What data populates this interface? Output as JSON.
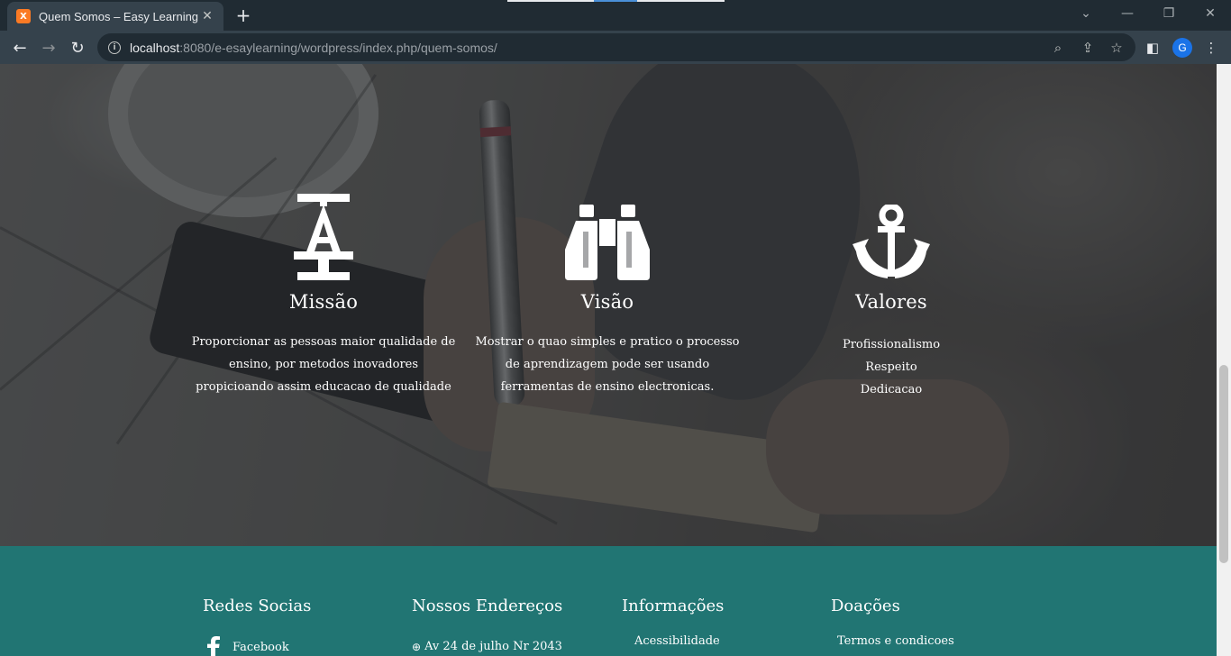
{
  "browser": {
    "tab_title": "Quem Somos – Easy Learning",
    "favicon_label": "X",
    "url_host": "localhost",
    "url_rest": ":8080/e-esaylearning/wordpress/index.php/quem-somos/",
    "profile_initial": "G"
  },
  "features": [
    {
      "icon": "caliper-icon",
      "title": "Missão",
      "text": "Proporcionar as pessoas maior qualidade de ensino, por metodos inovadores propicioando assim educacao de qualidade"
    },
    {
      "icon": "binoculars-icon",
      "title": "Visão",
      "text": "Mostrar o quao simples e pratico o processo de aprendizagem pode ser usando ferramentas de ensino electronicas."
    },
    {
      "icon": "anchor-icon",
      "title": "Valores",
      "values": [
        "Profissionalismo",
        "Respeito",
        "Dedicacao"
      ]
    }
  ],
  "footer": {
    "columns": [
      {
        "title": "Redes Socias",
        "item": "Facebook",
        "item_icon": "facebook-icon"
      },
      {
        "title": "Nossos Endereços",
        "item": "Av 24 de julho Nr 2043",
        "item_icon": "globe-icon"
      },
      {
        "title": "Informações",
        "item": "Acessibilidade"
      },
      {
        "title": "Doações",
        "item": "Termos e condicoes"
      }
    ]
  },
  "colors": {
    "footer_bg": "#217573",
    "tab_active": "#35424c",
    "favicon": "#fb7a24"
  }
}
